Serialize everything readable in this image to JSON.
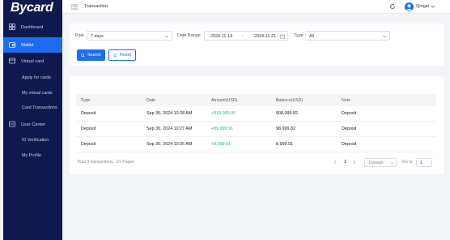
{
  "sidebar": {
    "logo": "Bycard",
    "items": [
      {
        "label": "Dashboard"
      },
      {
        "label": "Wallet"
      },
      {
        "label": "Virtual card"
      },
      {
        "label": "Apply for cards"
      },
      {
        "label": "My virtual cards"
      },
      {
        "label": "Card Transactions"
      },
      {
        "label": "User Center"
      },
      {
        "label": "ID Verification"
      },
      {
        "label": "My Profile"
      }
    ]
  },
  "header": {
    "title": "Transaction",
    "user_name": "Qingsi"
  },
  "filters": {
    "past_label": "Past",
    "past_value": "7 days",
    "date_range_label": "Date Range",
    "date_start": "2024-11-14",
    "date_separator": "~",
    "date_end": "2024-11-21",
    "type_label": "Type",
    "type_value": "All",
    "search_label": "Search",
    "reset_label": "Reset"
  },
  "table": {
    "columns": [
      "Type",
      "Date",
      "Amount(USD)",
      "Balance(USD)",
      "Note"
    ],
    "rows": [
      {
        "type": "Deposit",
        "date": "Sep 30, 2024 10:28 AM",
        "amount": "+810,000.00",
        "balance": "908,999.82",
        "note": "Deposit"
      },
      {
        "type": "Deposit",
        "date": "Sep 30, 2024 10:27 AM",
        "amount": "+89,999.91",
        "balance": "98,999.82",
        "note": "Deposit"
      },
      {
        "type": "Deposit",
        "date": "Sep 30, 2024 10:26 AM",
        "amount": "+8,999.91",
        "balance": "8,999.91",
        "note": "Deposit"
      }
    ],
    "total_text": "Total 3 transactions, 1/1 Pages"
  },
  "pagination": {
    "current_page": "1",
    "page_size": "10/page",
    "goto_label": "Go to",
    "goto_value": "1"
  },
  "colors": {
    "sidebar_bg": "#0e1a4e",
    "accent": "#1e6cf0",
    "positive": "#22b573"
  }
}
